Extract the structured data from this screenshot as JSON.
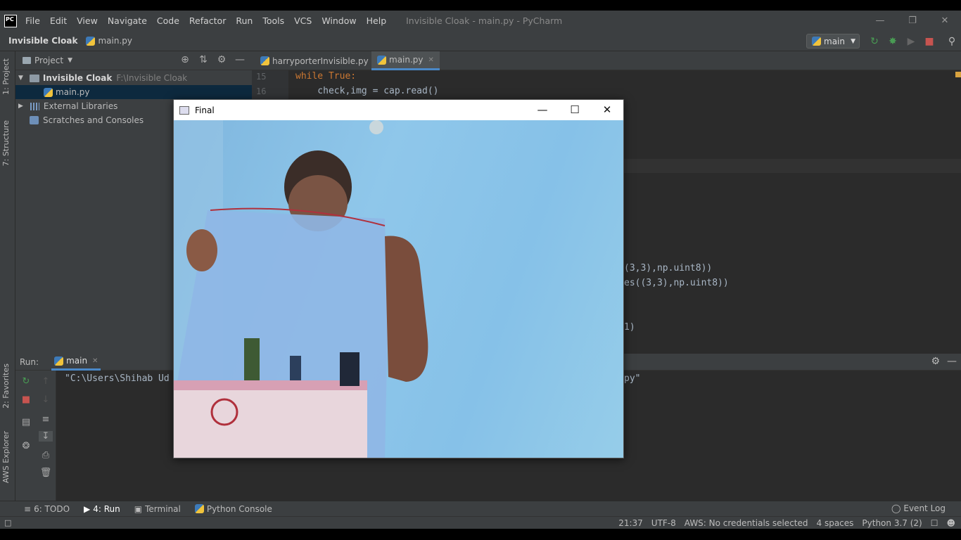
{
  "titlebar": {
    "logo": "PC",
    "menu": [
      "File",
      "Edit",
      "View",
      "Navigate",
      "Code",
      "Refactor",
      "Run",
      "Tools",
      "VCS",
      "Window",
      "Help"
    ],
    "window_title": "Invisible Cloak - main.py - PyCharm"
  },
  "navbar": {
    "project": "Invisible Cloak",
    "file": "main.py",
    "run_config": "main"
  },
  "left_stripe": {
    "project_tab": "1: Project",
    "structure_tab": "7: Structure",
    "favorites_tab": "2: Favorites",
    "aws_tab": "AWS Explorer"
  },
  "project_panel": {
    "title": "Project",
    "root_name": "Invisible Cloak",
    "root_path": "F:\\Invisible Cloak",
    "file": "main.py",
    "ext_libs": "External Libraries",
    "scratches": "Scratches and Consoles"
  },
  "editor": {
    "tabs": [
      "harryporterInvisible.py",
      "main.py"
    ],
    "lines": [
      {
        "no": "15",
        "kw": "while",
        "rest": " True:"
      },
      {
        "no": "16",
        "text": "    check,img = cap.read()"
      }
    ],
    "frag1": "(3,3),np.uint8))",
    "frag2": "es((3,3),np.uint8))",
    "frag3": "1)"
  },
  "run_panel": {
    "label": "Run:",
    "tab": "main",
    "output_left": "\"C:\\Users\\Shihab Ud",
    "output_right": "py\""
  },
  "bottom_stripe": {
    "todo": "6: TODO",
    "run": "4: Run",
    "terminal": "Terminal",
    "python_console": "Python Console",
    "event_log": "Event Log"
  },
  "statusbar": {
    "position": "21:37",
    "encoding": "UTF-8",
    "aws": "AWS: No credentials selected",
    "indent": "4 spaces",
    "interpreter": "Python 3.7 (2)"
  },
  "final_window": {
    "title": "Final"
  },
  "colors": {
    "accent": "#4a88c7",
    "editor_bg": "#2b2b2b",
    "panel_bg": "#3c3f41",
    "keyword": "#cc7832"
  }
}
